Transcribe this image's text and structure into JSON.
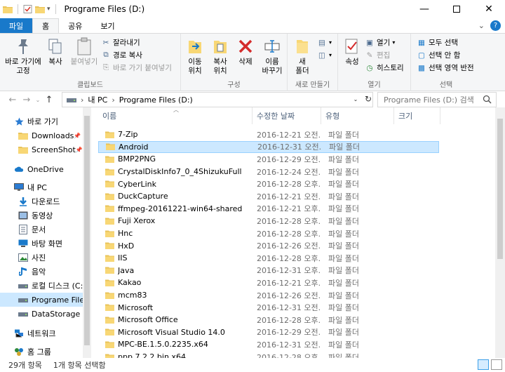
{
  "window": {
    "title": "Programe Files (D:)"
  },
  "tabs": [
    {
      "label": "파일"
    },
    {
      "label": "홈"
    },
    {
      "label": "공유"
    },
    {
      "label": "보기"
    }
  ],
  "ribbon": {
    "clipboard": {
      "label": "클립보드",
      "pin": "바로 가기에\n고정",
      "copy": "복사",
      "paste": "붙여넣기",
      "cut": "잘라내기",
      "copy_path": "경로 복사",
      "paste_shortcut": "바로 가기 붙여넣기"
    },
    "organize": {
      "label": "구성",
      "move_to": "이동\n위치",
      "copy_to": "복사\n위치",
      "delete": "삭제",
      "rename": "이름\n바꾸기"
    },
    "new": {
      "label": "새로 만들기",
      "new_folder": "새\n폴더"
    },
    "open": {
      "label": "열기",
      "properties": "속성",
      "open": "열기",
      "edit": "편집",
      "history": "히스토리"
    },
    "select": {
      "label": "선택",
      "select_all": "모두 선택",
      "select_none": "선택 안 함",
      "invert": "선택 영역 반전"
    }
  },
  "address": {
    "crumbs": [
      "내 PC",
      "Programe Files (D:)"
    ],
    "search_placeholder": "Programe Files (D:) 검색"
  },
  "nav": {
    "items": [
      {
        "label": "바로 가기",
        "icon": "star-icon",
        "indent": 0,
        "pinned": false,
        "selected": false
      },
      {
        "label": "Downloads",
        "icon": "folder-icon",
        "indent": 1,
        "pinned": true,
        "selected": false
      },
      {
        "label": "ScreenShot",
        "icon": "folder-icon",
        "indent": 1,
        "pinned": true,
        "selected": false
      },
      {
        "label": "OneDrive",
        "icon": "cloud-icon",
        "indent": 0,
        "pinned": false,
        "selected": false
      },
      {
        "label": "내 PC",
        "icon": "computer-icon",
        "indent": 0,
        "pinned": false,
        "selected": false
      },
      {
        "label": "다운로드",
        "icon": "download-icon",
        "indent": 1,
        "pinned": false,
        "selected": false
      },
      {
        "label": "동영상",
        "icon": "video-icon",
        "indent": 1,
        "pinned": false,
        "selected": false
      },
      {
        "label": "문서",
        "icon": "document-icon",
        "indent": 1,
        "pinned": false,
        "selected": false
      },
      {
        "label": "바탕 화면",
        "icon": "desktop-icon",
        "indent": 1,
        "pinned": false,
        "selected": false
      },
      {
        "label": "사진",
        "icon": "picture-icon",
        "indent": 1,
        "pinned": false,
        "selected": false
      },
      {
        "label": "음악",
        "icon": "music-icon",
        "indent": 1,
        "pinned": false,
        "selected": false
      },
      {
        "label": "로컬 디스크 (C:)",
        "icon": "drive-icon",
        "indent": 1,
        "pinned": false,
        "selected": false
      },
      {
        "label": "Programe Files (D:)",
        "icon": "drive-icon",
        "indent": 1,
        "pinned": false,
        "selected": true
      },
      {
        "label": "DataStorage (E:)",
        "icon": "drive-icon",
        "indent": 1,
        "pinned": false,
        "selected": false
      },
      {
        "label": "네트워크",
        "icon": "network-icon",
        "indent": 0,
        "pinned": false,
        "selected": false
      },
      {
        "label": "홈 그룹",
        "icon": "homegroup-icon",
        "indent": 0,
        "pinned": false,
        "selected": false
      }
    ]
  },
  "columns": {
    "name": "이름",
    "date": "수정한 날짜",
    "type": "유형",
    "size": "크기"
  },
  "files": [
    {
      "name": "7-Zip",
      "date": "2016-12-21 오전...",
      "type": "파일 폴더",
      "selected": false
    },
    {
      "name": "Android",
      "date": "2016-12-31 오전...",
      "type": "파일 폴더",
      "selected": true
    },
    {
      "name": "BMP2PNG",
      "date": "2016-12-29 오전...",
      "type": "파일 폴더",
      "selected": false
    },
    {
      "name": "CrystalDiskInfo7_0_4ShizukuFull",
      "date": "2016-12-24 오전...",
      "type": "파일 폴더",
      "selected": false
    },
    {
      "name": "CyberLink",
      "date": "2016-12-28 오후...",
      "type": "파일 폴더",
      "selected": false
    },
    {
      "name": "DuckCapture",
      "date": "2016-12-21 오전...",
      "type": "파일 폴더",
      "selected": false
    },
    {
      "name": "ffmpeg-20161221-win64-shared",
      "date": "2016-12-21 오후...",
      "type": "파일 폴더",
      "selected": false
    },
    {
      "name": "Fuji Xerox",
      "date": "2016-12-28 오후...",
      "type": "파일 폴더",
      "selected": false
    },
    {
      "name": "Hnc",
      "date": "2016-12-28 오후...",
      "type": "파일 폴더",
      "selected": false
    },
    {
      "name": "HxD",
      "date": "2016-12-26 오전...",
      "type": "파일 폴더",
      "selected": false
    },
    {
      "name": "IIS",
      "date": "2016-12-28 오후...",
      "type": "파일 폴더",
      "selected": false
    },
    {
      "name": "Java",
      "date": "2016-12-31 오후...",
      "type": "파일 폴더",
      "selected": false
    },
    {
      "name": "Kakao",
      "date": "2016-12-21 오후...",
      "type": "파일 폴더",
      "selected": false
    },
    {
      "name": "mcm83",
      "date": "2016-12-26 오전...",
      "type": "파일 폴더",
      "selected": false
    },
    {
      "name": "Microsoft",
      "date": "2016-12-31 오전...",
      "type": "파일 폴더",
      "selected": false
    },
    {
      "name": "Microsoft Office",
      "date": "2016-12-28 오후...",
      "type": "파일 폴더",
      "selected": false
    },
    {
      "name": "Microsoft Visual Studio 14.0",
      "date": "2016-12-29 오전...",
      "type": "파일 폴더",
      "selected": false
    },
    {
      "name": "MPC-BE.1.5.0.2235.x64",
      "date": "2016-12-31 오전...",
      "type": "파일 폴더",
      "selected": false
    },
    {
      "name": "ppp.7.2.2.bin.x64",
      "date": "2016-12-28 오후...",
      "type": "파일 폴더",
      "selected": false
    }
  ],
  "status": {
    "count": "29개 항목",
    "selection": "1개 항목 선택함"
  },
  "colors": {
    "accent": "#1979ca",
    "selection": "#cce8ff",
    "folder": "#f8d775"
  }
}
